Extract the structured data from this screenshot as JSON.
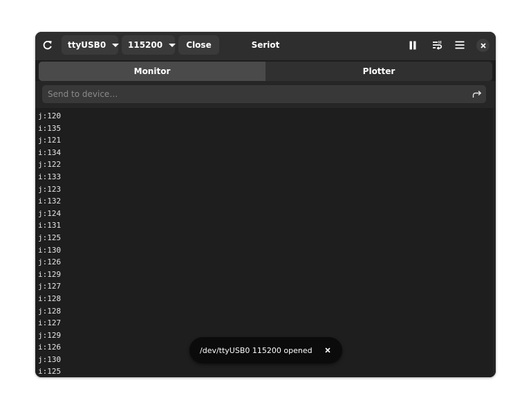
{
  "window": {
    "title": "Seriot"
  },
  "headerbar": {
    "refresh_icon": "refresh-icon",
    "port": {
      "selected": "ttyUSB0"
    },
    "baud": {
      "selected": "115200"
    },
    "close_label": "Close",
    "pause_icon": "pause-icon",
    "wrap_icon": "line-wrap-icon",
    "menu_icon": "hamburger-menu-icon",
    "window_close_icon": "close-icon"
  },
  "tabs": [
    {
      "label": "Monitor",
      "active": true
    },
    {
      "label": "Plotter",
      "active": false
    }
  ],
  "send": {
    "placeholder": "Send to device…",
    "value": "",
    "send_icon": "send-arrow-icon"
  },
  "monitor": {
    "lines": [
      "j:120",
      "i:135",
      "j:121",
      "i:134",
      "j:122",
      "i:133",
      "j:123",
      "i:132",
      "j:124",
      "i:131",
      "j:125",
      "i:130",
      "j:126",
      "i:129",
      "j:127",
      "i:128",
      "j:128",
      "i:127",
      "j:129",
      "i:126",
      "j:130",
      "i:125"
    ]
  },
  "toast": {
    "message": "/dev/ttyUSB0 115200 opened",
    "close_icon": "close-icon"
  },
  "colors": {
    "window_bg": "#1e1e1e",
    "headerbar_bg": "#2e2e2e",
    "toast_bg": "#0b0b0b"
  }
}
